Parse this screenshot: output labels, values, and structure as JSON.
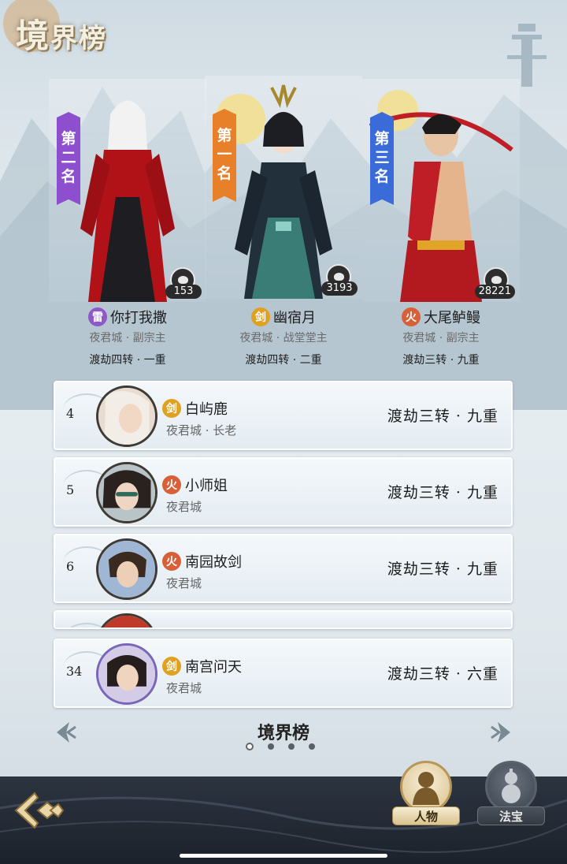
{
  "header": {
    "title_first": "境",
    "title_rest": "界榜"
  },
  "podium": [
    {
      "banner": [
        "第",
        "二",
        "名"
      ],
      "banner_color": "#8e4fcf",
      "likes": "153",
      "element": "雷",
      "element_class": "thunder",
      "name": "你打我撒",
      "sect": "夜君城 · 副宗主",
      "realm": "渡劫四转 · 一重"
    },
    {
      "banner": [
        "第",
        "一",
        "名"
      ],
      "banner_color": "#e8802a",
      "likes": "3193",
      "element": "剑",
      "element_class": "sword",
      "name": "幽宿月",
      "sect": "夜君城 · 战堂堂主",
      "realm": "渡劫四转 · 二重"
    },
    {
      "banner": [
        "第",
        "三",
        "名"
      ],
      "banner_color": "#3b6bd8",
      "likes": "28221",
      "element": "火",
      "element_class": "fire",
      "name": "大尾鲈鳗",
      "sect": "夜君城 · 副宗主",
      "realm": "渡劫三转 · 九重"
    }
  ],
  "list": [
    {
      "pos": "4",
      "element": "剑",
      "name": "白屿鹿",
      "sect": "夜君城 · 长老",
      "realm": "渡劫三转 · 九重"
    },
    {
      "pos": "5",
      "element": "火",
      "name": "小师姐",
      "sect": "夜君城",
      "realm": "渡劫三转 · 九重"
    },
    {
      "pos": "6",
      "element": "火",
      "name": "南园故剑",
      "sect": "夜君城",
      "realm": "渡劫三转 · 九重"
    },
    {
      "pos": "34",
      "element": "剑",
      "name": "南宫问天",
      "sect": "夜君城",
      "realm": "渡劫三转 · 六重"
    }
  ],
  "pager": {
    "title": "境界榜",
    "total_pages": 4,
    "current_page": 1
  },
  "bottom": {
    "person_label": "人物",
    "treasure_label": "法宝"
  },
  "icons": {
    "back": "back-arrow-icon",
    "likes": "like-bubble-icon",
    "prev": "chevron-left-icon",
    "next": "chevron-right-icon",
    "person": "person-silhouette-icon",
    "treasure": "gourd-icon"
  },
  "colors": {
    "thunder": "#8e58c8",
    "sword": "#e0a020",
    "fire": "#d86038"
  }
}
